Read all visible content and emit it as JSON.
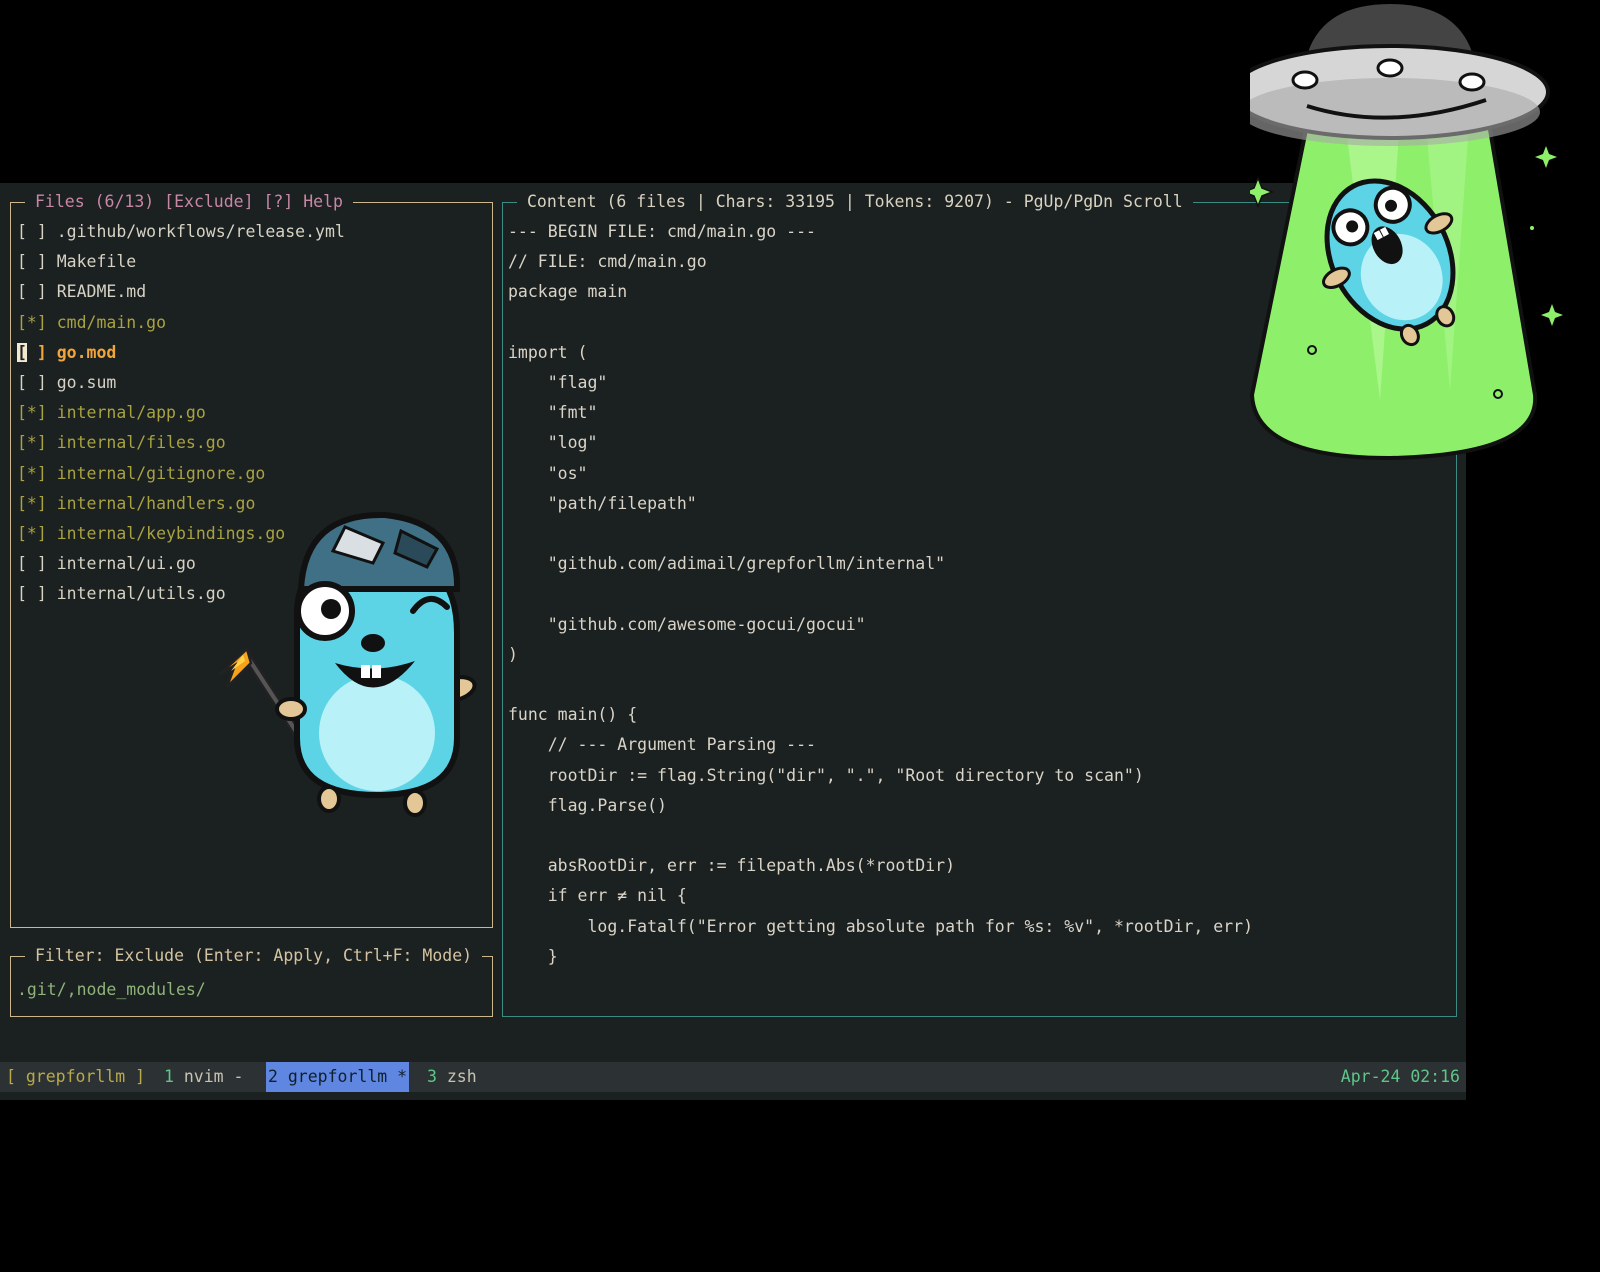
{
  "files_panel": {
    "title": "Files (6/13) [Exclude] [?] Help",
    "items": [
      {
        "check": "[ ]",
        "name": ".github/workflows/release.yml",
        "state": "unselected"
      },
      {
        "check": "[ ]",
        "name": "Makefile",
        "state": "unselected"
      },
      {
        "check": "[ ]",
        "name": "README.md",
        "state": "unselected"
      },
      {
        "check": "[*]",
        "name": "cmd/main.go",
        "state": "selected"
      },
      {
        "check": "[ ]",
        "name": "go.mod",
        "state": "cursor"
      },
      {
        "check": "[ ]",
        "name": "go.sum",
        "state": "unselected"
      },
      {
        "check": "[*]",
        "name": "internal/app.go",
        "state": "selected"
      },
      {
        "check": "[*]",
        "name": "internal/files.go",
        "state": "selected"
      },
      {
        "check": "[*]",
        "name": "internal/gitignore.go",
        "state": "selected"
      },
      {
        "check": "[*]",
        "name": "internal/handlers.go",
        "state": "selected"
      },
      {
        "check": "[*]",
        "name": "internal/keybindings.go",
        "state": "selected"
      },
      {
        "check": "[ ]",
        "name": "internal/ui.go",
        "state": "unselected"
      },
      {
        "check": "[ ]",
        "name": "internal/utils.go",
        "state": "unselected"
      }
    ]
  },
  "filter_panel": {
    "title": "Filter: Exclude (Enter: Apply, Ctrl+F: Mode)",
    "value": ".git/,node_modules/"
  },
  "content_panel": {
    "title": "Content (6 files | Chars: 33195 | Tokens: 9207) - PgUp/PgDn Scroll",
    "lines": [
      "--- BEGIN FILE: cmd/main.go ---",
      "// FILE: cmd/main.go",
      "package main",
      "",
      "import (",
      "    \"flag\"",
      "    \"fmt\"",
      "    \"log\"",
      "    \"os\"",
      "    \"path/filepath\"",
      "",
      "    \"github.com/adimail/grepforllm/internal\"",
      "",
      "    \"github.com/awesome-gocui/gocui\"",
      ")",
      "",
      "func main() {",
      "    // --- Argument Parsing ---",
      "    rootDir := flag.String(\"dir\", \".\", \"Root directory to scan\")",
      "    flag.Parse()",
      "",
      "    absRootDir, err := filepath.Abs(*rootDir)",
      "    if err ≠ nil {",
      "        log.Fatalf(\"Error getting absolute path for %s: %v\", *rootDir, err)",
      "    }"
    ]
  },
  "status_bar": {
    "session": "[ grepforllm ]",
    "windows": [
      {
        "index": "1",
        "name": "nvim -",
        "active": false
      },
      {
        "index": "2",
        "name": "grepforllm *",
        "active": true
      },
      {
        "index": "3",
        "name": "zsh",
        "active": false
      }
    ],
    "clock": "Apr-24 02:16"
  },
  "colors": {
    "terminal_bg": "#1b2021",
    "files_border": "#cdb58c",
    "content_border": "#3a8c82",
    "selected_file": "#a8a241",
    "cursor_file": "#f2a53a",
    "active_window": "#5f86e0",
    "ufo_beam": "#8ef06a",
    "gopher_blue": "#5dd4e6"
  },
  "decorations": {
    "left_art": "gopher-with-torch-illustration",
    "right_art": "ufo-abducting-gopher-illustration"
  }
}
